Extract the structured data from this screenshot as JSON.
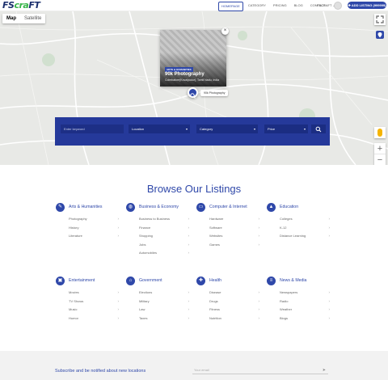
{
  "header": {
    "logo": {
      "part1": "FS",
      "part2": "cra",
      "part3": "FT"
    },
    "nav": [
      {
        "label": "HOMEPAGE",
        "active": true
      },
      {
        "label": "CATEGORY",
        "active": false
      },
      {
        "label": "PRICING",
        "active": false
      },
      {
        "label": "BLOG",
        "active": false
      },
      {
        "label": "CONTACT",
        "active": false
      }
    ],
    "user": "FSCRAFT ⌄",
    "add_listing": "✚ ADD LISTING (999999)"
  },
  "map": {
    "tabs": [
      "Map",
      "Satellite"
    ],
    "popup": {
      "category": "ARTS & HUMANITIES",
      "title": "90k Photography",
      "address": "Coimbatore(Kovaipudur), Tamil Nadu, India",
      "close": "×"
    },
    "marker_label": "90k Photography",
    "zoom_in": "+",
    "zoom_out": "−"
  },
  "search": {
    "keyword_placeholder": "Enter keyword",
    "location": "Location",
    "category": "Category",
    "price": "Price",
    "caret": "▾",
    "search_icon": "⌕"
  },
  "browse": {
    "title": "Browse Our Listings",
    "categories": [
      {
        "name": "Arts & Humanities",
        "icon": "edit-icon",
        "items": [
          "Photography",
          "History",
          "Literature"
        ]
      },
      {
        "name": "Business & Economy",
        "icon": "globe-icon",
        "items": [
          "Business to Business",
          "Finance",
          "Shopping",
          "Jobs",
          "Automobiles"
        ]
      },
      {
        "name": "Computer & Internet",
        "icon": "monitor-icon",
        "items": [
          "Hardware",
          "Software",
          "Websites",
          "Games"
        ]
      },
      {
        "name": "Education",
        "icon": "graduation-cap-icon",
        "items": [
          "Colleges",
          "K-12",
          "Distance Learning"
        ]
      },
      {
        "name": "Entertainment",
        "icon": "film-icon",
        "items": [
          "Movies",
          "TV Shows",
          "Music",
          "Humor"
        ]
      },
      {
        "name": "Government",
        "icon": "building-icon",
        "items": [
          "Elections",
          "Military",
          "Law",
          "Taxes"
        ]
      },
      {
        "name": "Health",
        "icon": "medkit-icon",
        "items": [
          "Disease",
          "Drugs",
          "Fitness",
          "Nutrition"
        ]
      },
      {
        "name": "News & Media",
        "icon": "newspaper-icon",
        "items": [
          "Newspapers",
          "Radio",
          "Weather",
          "Blogs"
        ]
      }
    ],
    "arrow": "›"
  },
  "footer": {
    "subscribe_text": "Subscribe and be notified about new locations",
    "email_placeholder": "Your email",
    "send_icon": "➤"
  },
  "colors": {
    "accent": "#2f48a9",
    "search_bar": "#25399a",
    "map_bg": "#e8e9e6",
    "footer_bg": "#f2f2f2"
  }
}
